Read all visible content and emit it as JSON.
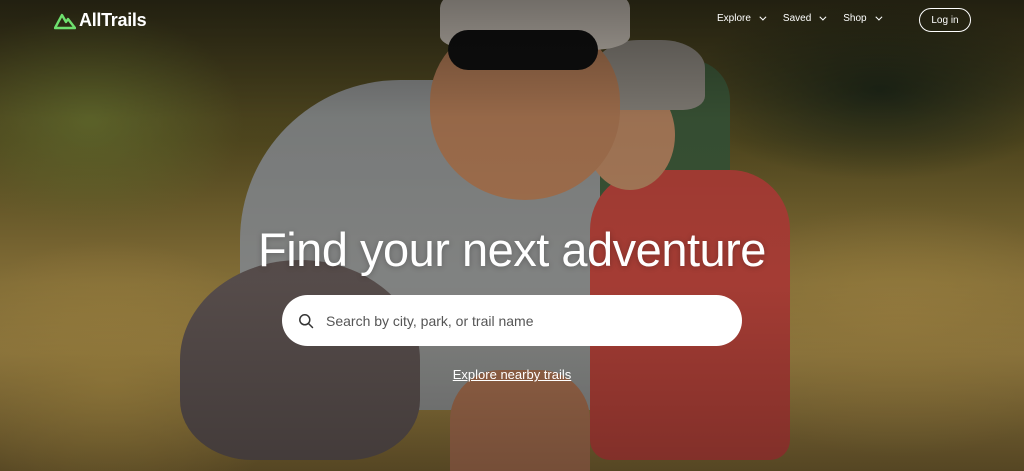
{
  "brand": {
    "name": "AllTrails",
    "logo_icon": "mountain-logo-icon",
    "accent": "#6ee06e"
  },
  "nav": {
    "items": [
      {
        "label": "Explore",
        "icon": "chevron-down-icon"
      },
      {
        "label": "Saved",
        "icon": "chevron-down-icon"
      },
      {
        "label": "Shop",
        "icon": "chevron-down-icon"
      }
    ],
    "login_label": "Log in"
  },
  "hero": {
    "title": "Find your next adventure",
    "search": {
      "placeholder": "Search by city, park, or trail name",
      "value": "",
      "icon": "search-icon"
    },
    "explore_link": "Explore nearby trails"
  }
}
